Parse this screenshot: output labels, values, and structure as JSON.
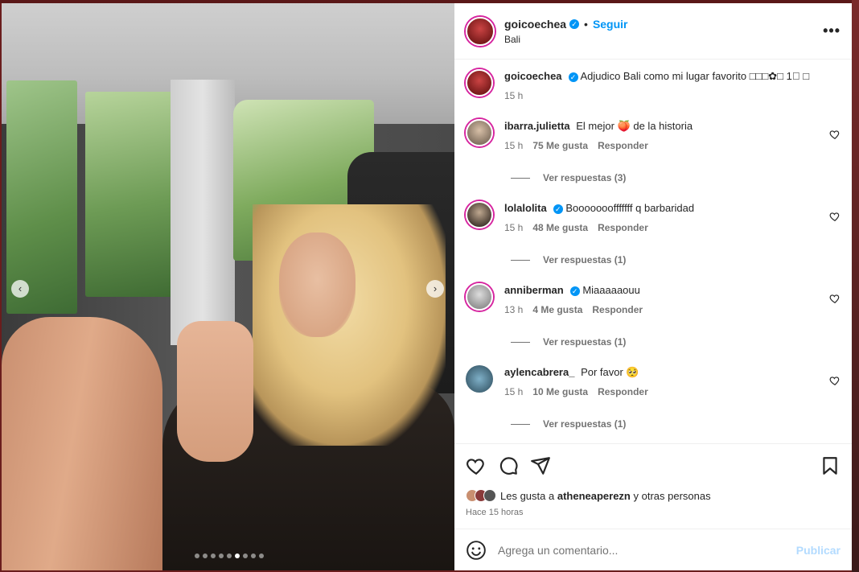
{
  "post": {
    "username": "goicoechea",
    "follow_label": "Seguir",
    "location": "Bali",
    "more_label": "•••",
    "bullet": "•"
  },
  "caption": {
    "username": "goicoechea",
    "text": "Adjudico Bali como mi lugar favorito □□□✿□ 1⃣ □",
    "time": "15 h"
  },
  "comments": [
    {
      "username": "ibarra.julietta",
      "verified": false,
      "text": "El mejor 🍑 de la historia",
      "time": "15 h",
      "likes": "75 Me gusta",
      "reply": "Responder",
      "replies": "Ver respuestas (3)"
    },
    {
      "username": "lolalolita",
      "verified": true,
      "text": "Booooooofffffff q barbaridad",
      "time": "15 h",
      "likes": "48 Me gusta",
      "reply": "Responder",
      "replies": "Ver respuestas (1)"
    },
    {
      "username": "anniberman",
      "verified": true,
      "text": "Miaaaaaouu",
      "time": "13 h",
      "likes": "4 Me gusta",
      "reply": "Responder",
      "replies": "Ver respuestas (1)"
    },
    {
      "username": "aylencabrera_",
      "verified": false,
      "text": "Por favor 🥺",
      "time": "15 h",
      "likes": "10 Me gusta",
      "reply": "Responder",
      "replies": "Ver respuestas (1)"
    }
  ],
  "likes_summary": {
    "prefix": "Les gusta a",
    "user": "atheneaperezn",
    "suffix": "y otras personas"
  },
  "posted_time": "Hace 15 horas",
  "composer": {
    "placeholder": "Agrega un comentario...",
    "publish_label": "Publicar"
  },
  "carousel": {
    "prev": "‹",
    "next": "›",
    "dot_count": 9,
    "active_index": 5
  },
  "colors": {
    "accent": "#0095f6",
    "publish_disabled": "#b3dbff",
    "story_ring": "#d6249f"
  }
}
